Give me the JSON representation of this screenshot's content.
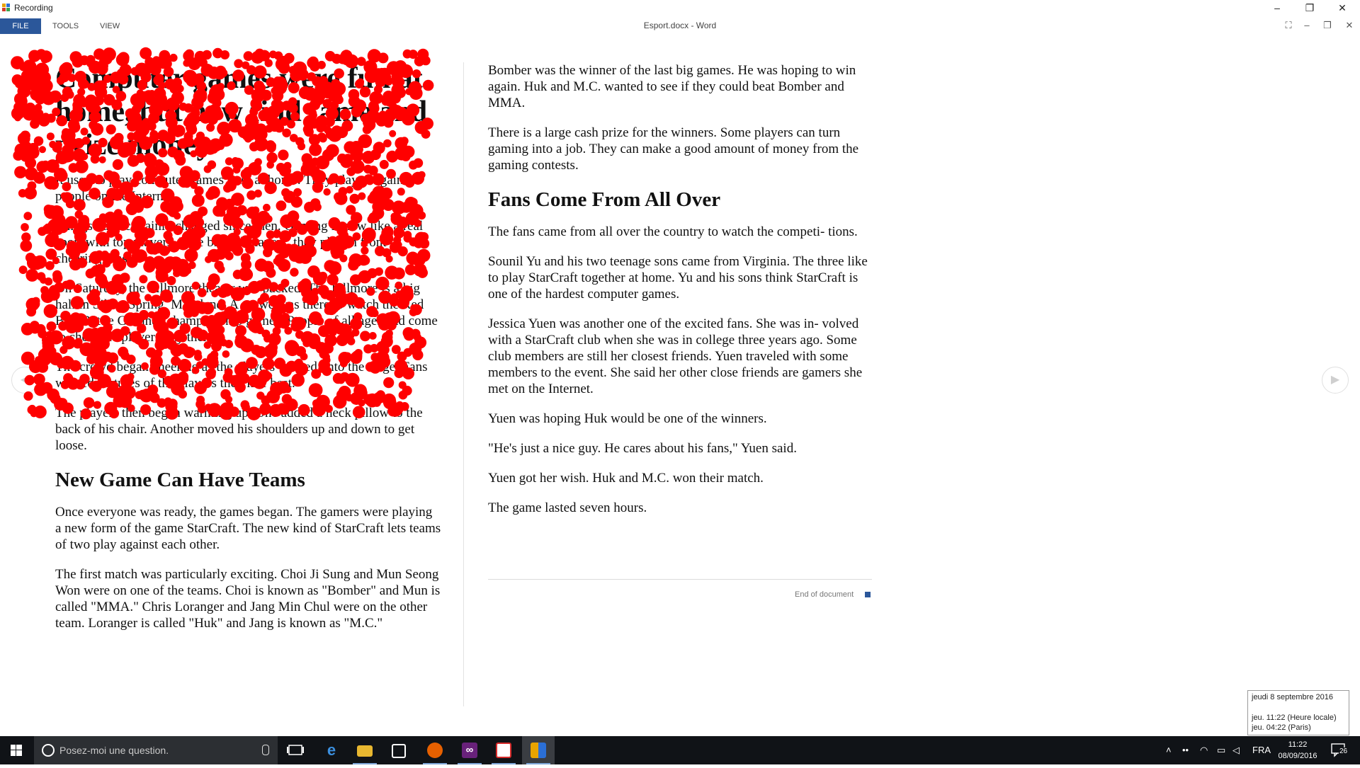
{
  "recording_window": {
    "title": "Recording",
    "minimize": "–",
    "restore": "❐",
    "close": "✕"
  },
  "word": {
    "doc_title": "Esport.docx - Word",
    "menu": [
      "FILE",
      "TOOLS",
      "VIEW"
    ],
    "controls": {
      "fit": "⛶",
      "minimize": "–",
      "restore": "❐",
      "close": "✕"
    },
    "accent": "#2b579a"
  },
  "document": {
    "left_column": {
      "heading": "Computer games were fun at home, but now find fame and prize money",
      "paragraphs": [
        "It used to play computer games only at home. They played against people on the Internet.",
        "Things have certainly changed since then. Gaming is now like a real sport with top players. Like big ballplayers, they play in front of cheering fans.",
        "On Saturday, the Fillmore theater was packed. The Fillmore is a big hall in Silver Spring, Maryland. A crowd was there to watch the Red Bull Battle Grounds championship games. People of all ages had come to cheer the players together.",
        "The crowd began cheering as the players walked onto the stage. Fans wanted pictures of the players they like best.",
        "The players then began warming up. One added a neck pillow to the back of his chair. Another moved his shoulders up and down to get loose."
      ],
      "subheading": "New Game Can Have Teams",
      "paragraphs_2": [
        "Once everyone was ready, the games began. The gamers were playing a new form of the game StarCraft. The new kind of StarCraft lets teams of two play against each other.",
        "The first match was particularly exciting. Choi Ji Sung and Mun Seong Won were on one of the teams. Choi is known as \"Bomber\" and Mun is called \"MMA.\" Chris Loranger and Jang Min Chul were on the other team. Loranger is called \"Huk\" and Jang is known as \"M.C.\""
      ]
    },
    "right_column": {
      "paragraphs": [
        "Bomber was the winner of the last big games. He was hoping to win again. Huk and M.C. wanted to see if they could beat Bomber and MMA.",
        "There is a large cash prize for the winners. Some players can turn gaming into a job. They can make a good amount of money from the gaming contests."
      ],
      "subheading": "Fans Come From All Over",
      "paragraphs_2": [
        "The fans came from all over the country to watch the competi- tions.",
        "Sounil Yu and his two teenage sons came from Virginia. The three like to play StarCraft together at home. Yu and his sons think StarCraft is one of the hardest computer games.",
        "Jessica Yuen was another one of the excited fans. She was in- volved with a StarCraft club when she was in college three years ago. Some club members are still her closest friends. Yuen traveled with some members to the event. She said her other close friends are gamers she met on the Internet.",
        "Yuen was hoping Huk would be one of the winners.",
        "\"He's just a nice guy. He cares about his fans,\" Yuen said.",
        "Yuen got her wish. Huk and M.C. won their match.",
        "The game lasted seven hours."
      ],
      "end_label": "End of document"
    },
    "nav": {
      "prev": "◀",
      "next": "▶"
    },
    "scribble_color": "#ff0000"
  },
  "clock_popup": {
    "date": "jeudi 8 septembre 2016",
    "local": "jeu. 11:22  (Heure locale)",
    "paris": "jeu. 04:22  (Paris)"
  },
  "taskbar": {
    "search_placeholder": "Posez-moi une question.",
    "language": "FRA",
    "time": "11:22",
    "date": "08/09/2016",
    "notification_count": "26",
    "apps": [
      "task-view-icon",
      "edge-icon",
      "file-explorer-icon",
      "store-icon",
      "firefox-icon",
      "visual-studio-icon",
      "acrobat-icon",
      "recording-app-icon"
    ]
  }
}
